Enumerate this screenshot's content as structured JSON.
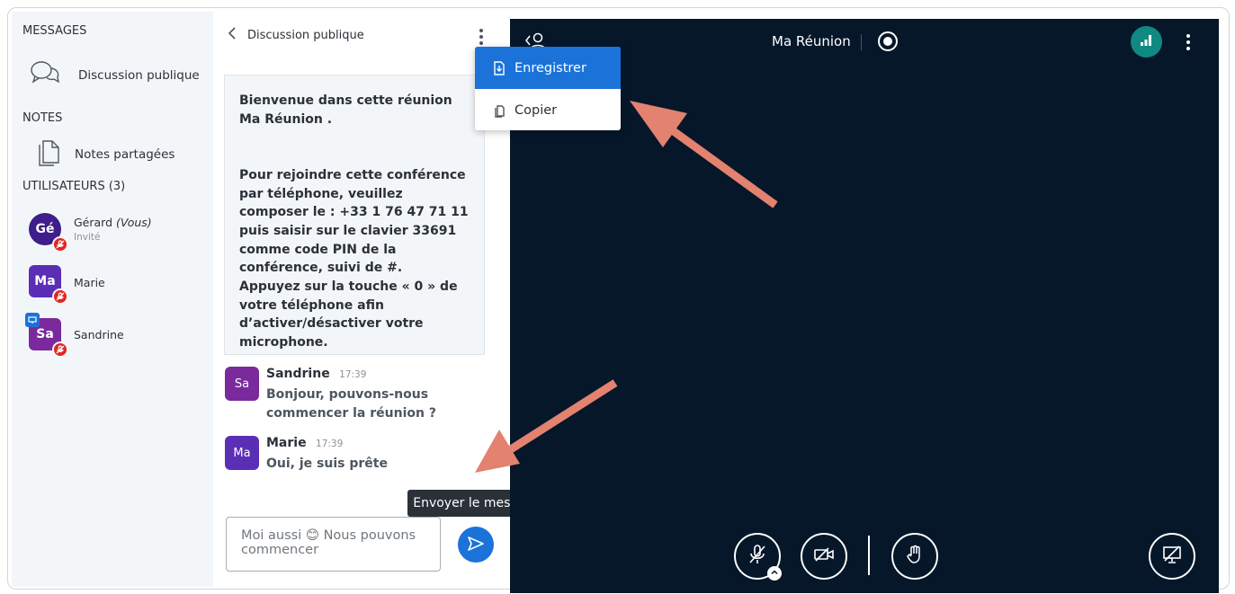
{
  "sidebar": {
    "messages_title": "MESSAGES",
    "public_chat_label": "Discussion publique",
    "notes_title": "NOTES",
    "shared_notes_label": "Notes partagées",
    "users_title": "UTILISATEURS (3)",
    "users": [
      {
        "initials": "Gé",
        "name": "Gérard",
        "you_suffix": "(Vous)",
        "role": "Invité",
        "color": "#3f1d8a"
      },
      {
        "initials": "Ma",
        "name": "Marie",
        "color": "#5b2fb5"
      },
      {
        "initials": "Sa",
        "name": "Sandrine",
        "color": "#7a2a9c"
      }
    ]
  },
  "chat": {
    "title": "Discussion publique",
    "welcome_lines": "Bienvenue dans cette réunion Ma Réunion .\n\n\nPour rejoindre cette conférence par téléphone, veuillez composer le : +33 1 76 47 71 11\npuis saisir sur le clavier 33691 comme code PIN de la conférence, suivi de #.\nAppuyez sur la touche « 0 » de votre téléphone afin d’activer/désactiver votre microphone.",
    "messages": [
      {
        "initials": "Sa",
        "name": "Sandrine",
        "time": "17:39",
        "text": "Bonjour, pouvons-nous commencer la réunion ?",
        "color": "#7a2a9c"
      },
      {
        "initials": "Ma",
        "name": "Marie",
        "time": "17:39",
        "text": "Oui, je suis prête",
        "color": "#5b2fb5"
      }
    ],
    "composer_value": "Moi aussi 😊 Nous pouvons commencer",
    "send_tooltip": "Envoyer le message"
  },
  "menu": {
    "save_label": "Enregistrer",
    "copy_label": "Copier"
  },
  "main": {
    "meeting_title": "Ma Réunion"
  },
  "colors": {
    "accent": "#1b72d9",
    "main_bg": "#06172a",
    "mute_red": "#df2721",
    "annotation_arrow": "#e3826f"
  }
}
